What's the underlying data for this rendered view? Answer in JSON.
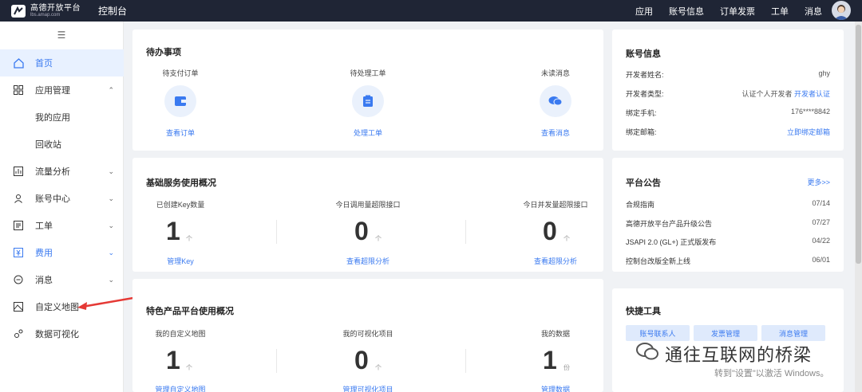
{
  "header": {
    "logo_name": "高德开放平台",
    "logo_sub": "lbs.amap.com",
    "console": "控制台",
    "nav": [
      "应用",
      "账号信息",
      "订单发票",
      "工单",
      "消息"
    ]
  },
  "sidebar": {
    "items": [
      {
        "label": "首页"
      },
      {
        "label": "应用管理"
      },
      {
        "label": "我的应用"
      },
      {
        "label": "回收站"
      },
      {
        "label": "流量分析"
      },
      {
        "label": "账号中心"
      },
      {
        "label": "工单"
      },
      {
        "label": "费用"
      },
      {
        "label": "消息"
      },
      {
        "label": "自定义地图"
      },
      {
        "label": "数据可视化"
      }
    ]
  },
  "todo": {
    "title": "待办事项",
    "cols": [
      {
        "label": "待支付订单",
        "link": "查看订单"
      },
      {
        "label": "待处理工单",
        "link": "处理工单"
      },
      {
        "label": "未读消息",
        "link": "查看消息"
      }
    ]
  },
  "basic": {
    "title": "基础服务使用概况",
    "cols": [
      {
        "label": "已创建Key数量",
        "value": "1",
        "unit": "个",
        "link": "管理Key"
      },
      {
        "label": "今日调用量超限接口",
        "value": "0",
        "unit": "个",
        "link": "查看超限分析"
      },
      {
        "label": "今日并发量超限接口",
        "value": "0",
        "unit": "个",
        "link": "查看超限分析"
      }
    ]
  },
  "special": {
    "title": "特色产品平台使用概况",
    "cols": [
      {
        "label": "我的自定义地图",
        "value": "1",
        "unit": "个",
        "link": "管理自定义地图"
      },
      {
        "label": "我的可视化项目",
        "value": "0",
        "unit": "个",
        "link": "管理可视化项目"
      },
      {
        "label": "我的数据",
        "value": "1",
        "unit": "份",
        "link": "管理数据"
      }
    ]
  },
  "account": {
    "title": "账号信息",
    "rows": [
      {
        "label": "开发者姓名:",
        "value": "ghy"
      },
      {
        "label": "开发者类型:",
        "value": "认证个人开发者",
        "link": "开发者认证"
      },
      {
        "label": "绑定手机:",
        "value": "176****8842"
      },
      {
        "label": "绑定邮箱:",
        "link": "立即绑定邮箱"
      }
    ]
  },
  "notice": {
    "title": "平台公告",
    "more": "更多>>",
    "rows": [
      {
        "label": "合规指南",
        "date": "07/14"
      },
      {
        "label": "高德开放平台产品升级公告",
        "date": "07/27"
      },
      {
        "label": "JSAPI 2.0 (GL+) 正式版发布",
        "date": "04/22"
      },
      {
        "label": "控制台改版全新上线",
        "date": "06/01"
      }
    ]
  },
  "tools": {
    "title": "快捷工具",
    "buttons": [
      "账号联系人",
      "发票管理",
      "消息管理"
    ]
  },
  "watermark": {
    "title": "通往互联网的桥梁",
    "activate": "转到\"设置\"以激活 Windows。"
  },
  "colors": {
    "accent": "#3a7af0",
    "topbar": "#1f2535",
    "annotation_arrow": "#e53935"
  }
}
